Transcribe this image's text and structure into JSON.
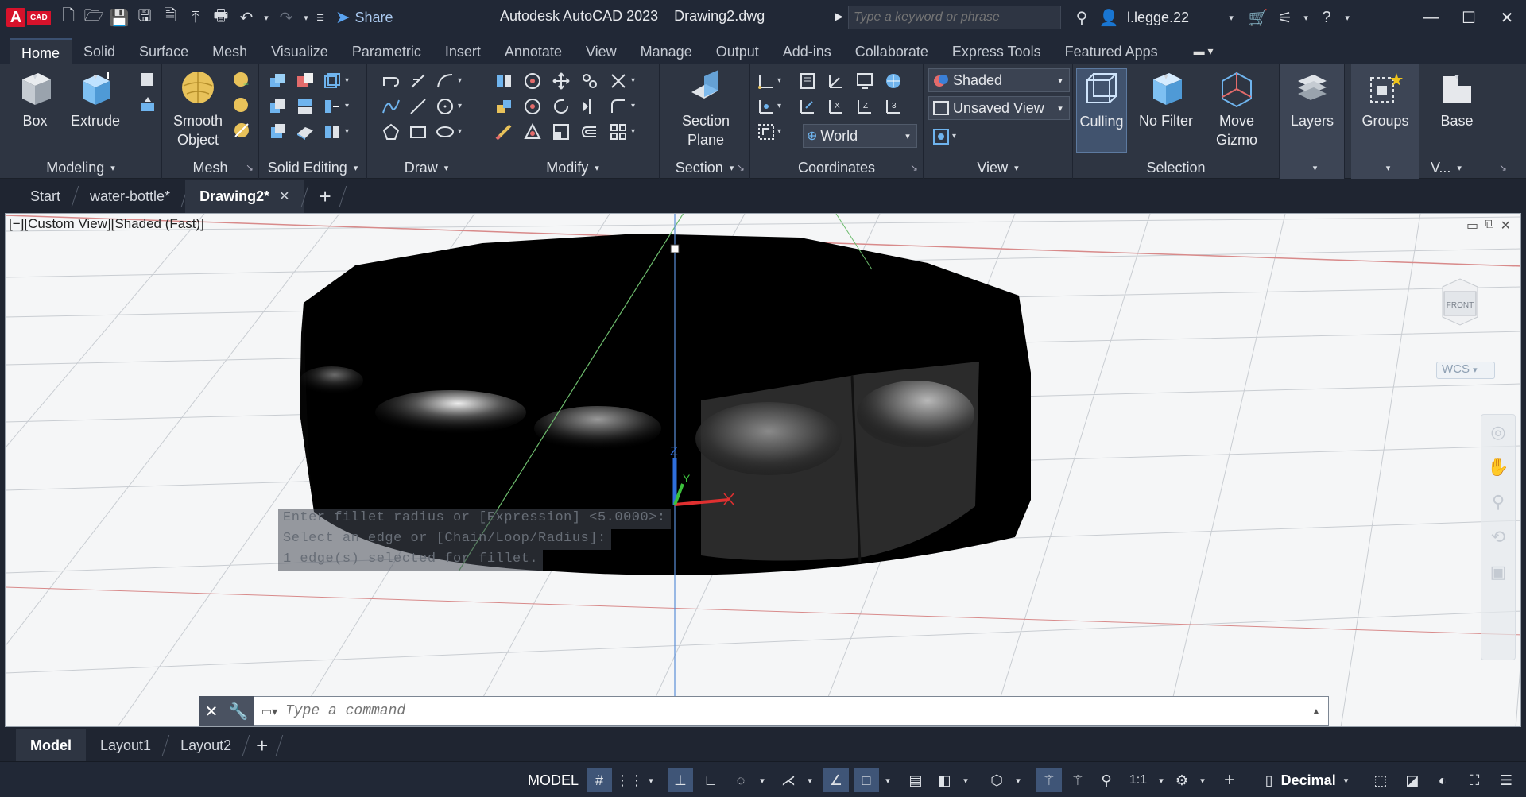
{
  "app": {
    "badge": "A",
    "badge_suffix": "CAD",
    "title": "Autodesk AutoCAD 2023",
    "document": "Drawing2.dwg"
  },
  "quick_access": {
    "share_label": "Share"
  },
  "search": {
    "placeholder": "Type a keyword or phrase"
  },
  "user": {
    "name": "l.legge.22"
  },
  "ribbon_tabs": [
    "Home",
    "Solid",
    "Surface",
    "Mesh",
    "Visualize",
    "Parametric",
    "Insert",
    "Annotate",
    "View",
    "Manage",
    "Output",
    "Add-ins",
    "Collaborate",
    "Express Tools",
    "Featured Apps"
  ],
  "ribbon": {
    "modeling": {
      "title": "Modeling",
      "box": "Box",
      "extrude": "Extrude"
    },
    "mesh": {
      "title": "Mesh",
      "smooth_line1": "Smooth",
      "smooth_line2": "Object"
    },
    "solid_editing": {
      "title": "Solid Editing"
    },
    "draw": {
      "title": "Draw"
    },
    "modify": {
      "title": "Modify"
    },
    "section": {
      "title": "Section",
      "line1": "Section",
      "line2": "Plane"
    },
    "coordinates": {
      "title": "Coordinates",
      "ucs_combo": "World"
    },
    "view": {
      "title": "View",
      "visual_style": "Shaded",
      "named_view": "Unsaved View"
    },
    "selection": {
      "title": "Selection",
      "culling": "Culling",
      "no_filter": "No Filter",
      "gizmo_line1": "Move",
      "gizmo_line2": "Gizmo"
    },
    "layers": {
      "label": "Layers"
    },
    "groups": {
      "label": "Groups"
    },
    "base": {
      "label": "Base",
      "title": "V..."
    }
  },
  "doc_tabs": [
    {
      "label": "Start"
    },
    {
      "label": "water-bottle*"
    },
    {
      "label": "Drawing2*"
    }
  ],
  "viewport": {
    "label": "[−][Custom View][Shaded (Fast)]",
    "viewcube_face": "FRONT",
    "wcs": "WCS",
    "ucs_z": "Z",
    "ucs_y": "Y",
    "history": [
      "Enter fillet radius or [Expression] <5.0000>:",
      "Select an edge or [Chain/Loop/Radius]:",
      "1 edge(s) selected for fillet."
    ]
  },
  "command": {
    "placeholder": "Type a command"
  },
  "layout_tabs": [
    "Model",
    "Layout1",
    "Layout2"
  ],
  "status": {
    "model": "MODEL",
    "scale": "1:1",
    "units": "Decimal"
  },
  "colors": {
    "accent": "#3b5070",
    "background": "#1f2531",
    "ribbon": "#2e3542",
    "viewport": "#f5f6f7"
  }
}
